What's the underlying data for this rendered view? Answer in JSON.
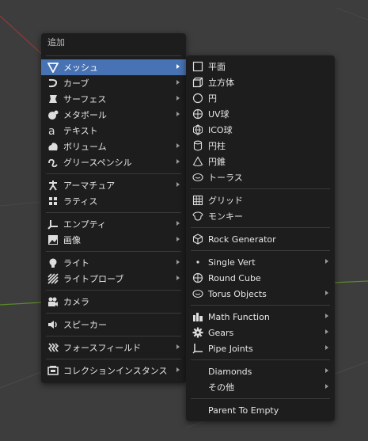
{
  "main_menu": {
    "title": "追加",
    "items": [
      {
        "label": "メッシュ",
        "icon": "mesh-icon",
        "submenu": true,
        "active": true
      },
      {
        "label": "カーブ",
        "icon": "curve-icon",
        "submenu": true
      },
      {
        "label": "サーフェス",
        "icon": "surface-icon",
        "submenu": true
      },
      {
        "label": "メタボール",
        "icon": "metaball-icon",
        "submenu": true
      },
      {
        "label": "テキスト",
        "icon": "text-icon",
        "submenu": false
      },
      {
        "label": "ボリューム",
        "icon": "volume-icon",
        "submenu": true
      },
      {
        "label": "グリースペンシル",
        "icon": "grease-pencil-icon",
        "submenu": true
      },
      {
        "label": "アーマチュア",
        "icon": "armature-icon",
        "submenu": true
      },
      {
        "label": "ラティス",
        "icon": "lattice-icon",
        "submenu": false
      },
      {
        "label": "エンプティ",
        "icon": "empty-icon",
        "submenu": true
      },
      {
        "label": "画像",
        "icon": "image-icon",
        "submenu": true
      },
      {
        "label": "ライト",
        "icon": "light-icon",
        "submenu": true
      },
      {
        "label": "ライトプローブ",
        "icon": "light-probe-icon",
        "submenu": true
      },
      {
        "label": "カメラ",
        "icon": "camera-icon",
        "submenu": false
      },
      {
        "label": "スピーカー",
        "icon": "speaker-icon",
        "submenu": false
      },
      {
        "label": "フォースフィールド",
        "icon": "force-field-icon",
        "submenu": true
      },
      {
        "label": "コレクションインスタンス",
        "icon": "collection-instance-icon",
        "submenu": true
      }
    ]
  },
  "mesh_menu": {
    "items": [
      {
        "label": "平面",
        "icon": "plane-icon",
        "submenu": false
      },
      {
        "label": "立方体",
        "icon": "cube-icon",
        "submenu": false
      },
      {
        "label": "円",
        "icon": "circle-icon",
        "submenu": false
      },
      {
        "label": "UV球",
        "icon": "uv-sphere-icon",
        "submenu": false
      },
      {
        "label": "ICO球",
        "icon": "ico-sphere-icon",
        "submenu": false
      },
      {
        "label": "円柱",
        "icon": "cylinder-icon",
        "submenu": false
      },
      {
        "label": "円錐",
        "icon": "cone-icon",
        "submenu": false
      },
      {
        "label": "トーラス",
        "icon": "torus-icon",
        "submenu": false
      },
      {
        "label": "グリッド",
        "icon": "grid-icon",
        "submenu": false
      },
      {
        "label": "モンキー",
        "icon": "monkey-icon",
        "submenu": false
      },
      {
        "label": "Rock Generator",
        "icon": "rock-icon",
        "submenu": false
      },
      {
        "label": "Single Vert",
        "icon": "vertex-icon",
        "submenu": true
      },
      {
        "label": "Round Cube",
        "icon": "round-cube-icon",
        "submenu": false
      },
      {
        "label": "Torus Objects",
        "icon": "torus-objects-icon",
        "submenu": true
      },
      {
        "label": "Math Function",
        "icon": "math-function-icon",
        "submenu": true
      },
      {
        "label": "Gears",
        "icon": "gears-icon",
        "submenu": true
      },
      {
        "label": "Pipe Joints",
        "icon": "pipe-joints-icon",
        "submenu": true
      },
      {
        "label": "Diamonds",
        "icon": "",
        "submenu": true
      },
      {
        "label": "その他",
        "icon": "",
        "submenu": true
      },
      {
        "label": "Parent To Empty",
        "icon": "",
        "submenu": false
      }
    ]
  },
  "colors": {
    "menu_bg": "#1d1d1d",
    "highlight": "#4772b3",
    "viewport_bg": "#3d3d3d",
    "axis_red": "#8a3a3a",
    "axis_green": "#5a8a2a"
  }
}
